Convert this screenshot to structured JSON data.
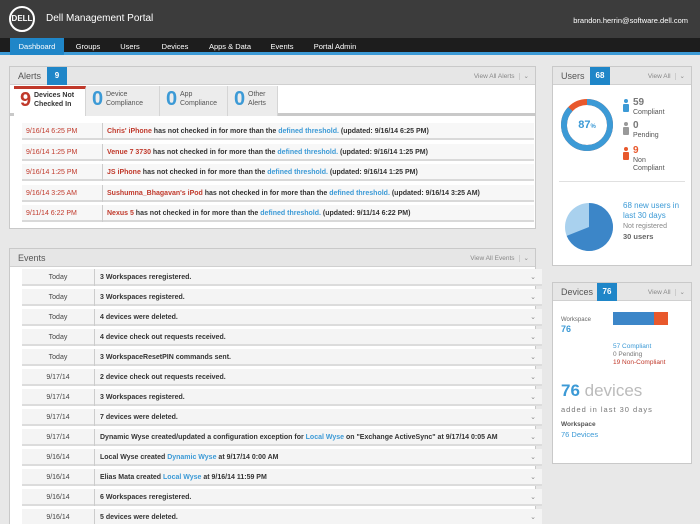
{
  "header": {
    "logo": "DELL",
    "title": "Dell Management Portal",
    "user": "brandon.herrin@software.dell.com"
  },
  "nav": {
    "tabs": [
      "Dashboard",
      "Groups",
      "Users",
      "Devices",
      "Apps & Data",
      "Events",
      "Portal Admin"
    ],
    "active": "Dashboard"
  },
  "alerts": {
    "title": "Alerts",
    "count": "9",
    "view_all": "View All Alerts",
    "tabs": [
      {
        "count": "9",
        "label1": "Devices Not",
        "label2": "Checked In"
      },
      {
        "count": "0",
        "label1": "Device",
        "label2": "Compliance"
      },
      {
        "count": "0",
        "label1": "App",
        "label2": "Compliance"
      },
      {
        "count": "0",
        "label1": "Other",
        "label2": "Alerts"
      }
    ],
    "rows": [
      {
        "time": "9/16/14 6:25 PM",
        "device": "Chris' iPhone",
        "text": " has not checked in for more than the ",
        "link": "defined threshold.",
        "updated": " (updated: 9/16/14 6:25 PM)"
      },
      {
        "time": "9/16/14 1:25 PM",
        "device": "Venue 7 3730",
        "text": " has not checked in for more than the ",
        "link": "defined threshold.",
        "updated": " (updated: 9/16/14 1:25 PM)"
      },
      {
        "time": "9/16/14 1:25 PM",
        "device": "JS iPhone",
        "text": " has not checked in for more than the ",
        "link": "defined threshold.",
        "updated": " (updated: 9/16/14 1:25 PM)"
      },
      {
        "time": "9/16/14 3:25 AM",
        "device": "Sushumna_Bhagavan's iPod",
        "text": " has not checked in for more than the ",
        "link": "defined threshold.",
        "updated": " (updated: 9/16/14 3:25 AM)"
      },
      {
        "time": "9/11/14 6:22 PM",
        "device": "Nexus 5",
        "text": " has not checked in for more than the ",
        "link": "defined threshold.",
        "updated": " (updated: 9/11/14 6:22 PM)"
      }
    ]
  },
  "events": {
    "title": "Events",
    "view_all": "View All Events",
    "rows": [
      {
        "date": "Today",
        "pre": "3 Workspaces reregistered.",
        "link": "",
        "post": ""
      },
      {
        "date": "Today",
        "pre": "3 Workspaces registered.",
        "link": "",
        "post": ""
      },
      {
        "date": "Today",
        "pre": "4 devices were deleted.",
        "link": "",
        "post": ""
      },
      {
        "date": "Today",
        "pre": "4 device check out requests received.",
        "link": "",
        "post": ""
      },
      {
        "date": "Today",
        "pre": "3 WorkspaceResetPIN commands sent.",
        "link": "",
        "post": ""
      },
      {
        "date": "9/17/14",
        "pre": "2 device check out requests received.",
        "link": "",
        "post": ""
      },
      {
        "date": "9/17/14",
        "pre": "3 Workspaces registered.",
        "link": "",
        "post": ""
      },
      {
        "date": "9/17/14",
        "pre": "7 devices were deleted.",
        "link": "",
        "post": ""
      },
      {
        "date": "9/17/14",
        "pre": "Dynamic Wyse created/updated a configuration exception for ",
        "link": "Local Wyse",
        "post": " on \"Exchange ActiveSync\" at 9/17/14 0:05 AM"
      },
      {
        "date": "9/16/14",
        "pre": "Local Wyse created ",
        "link": "Dynamic Wyse",
        "post": " at 9/17/14 0:00 AM"
      },
      {
        "date": "9/16/14",
        "pre": "Elias Mata created ",
        "link": "Local Wyse",
        "post": " at 9/16/14 11:59 PM"
      },
      {
        "date": "9/16/14",
        "pre": "6 Workspaces reregistered.",
        "link": "",
        "post": ""
      },
      {
        "date": "9/16/14",
        "pre": "5 devices were deleted.",
        "link": "",
        "post": ""
      }
    ]
  },
  "users": {
    "title": "Users",
    "count": "68",
    "view_all": "View All",
    "compliance_pct": 87,
    "compliance_label": "87",
    "pct_sign": "%",
    "compliant_num": "59",
    "compliant_lbl": "Compliant",
    "pending_num": "0",
    "pending_lbl": "Pending",
    "noncompliant_num": "9",
    "noncompliant_lbl1": "Non",
    "noncompliant_lbl2": "Compliant",
    "new_users_line1": "68 new users in",
    "new_users_line2": "last 30 days",
    "not_registered": "Not registered",
    "total_users": "30 users",
    "new_fraction": 0.69
  },
  "devices": {
    "title": "Devices",
    "count": "76",
    "view_all": "View All",
    "workspace_lbl": "Workspace",
    "workspace_num": "76",
    "compliant_fraction": 0.75,
    "compliant": "57 Compliant",
    "pending": "0 Pending",
    "noncompliant": "19 Non-Compliant",
    "big_line": "76 devices",
    "big_num": "76",
    "big_word": " devices",
    "added": "added in last 30 days",
    "ws_label": "Workspace",
    "ws_devices": "76 Devices"
  },
  "colors": {
    "accent": "#1f86c8",
    "alert_red": "#c0392b",
    "link_blue": "#3c9ad6",
    "orange": "#e8582c"
  }
}
